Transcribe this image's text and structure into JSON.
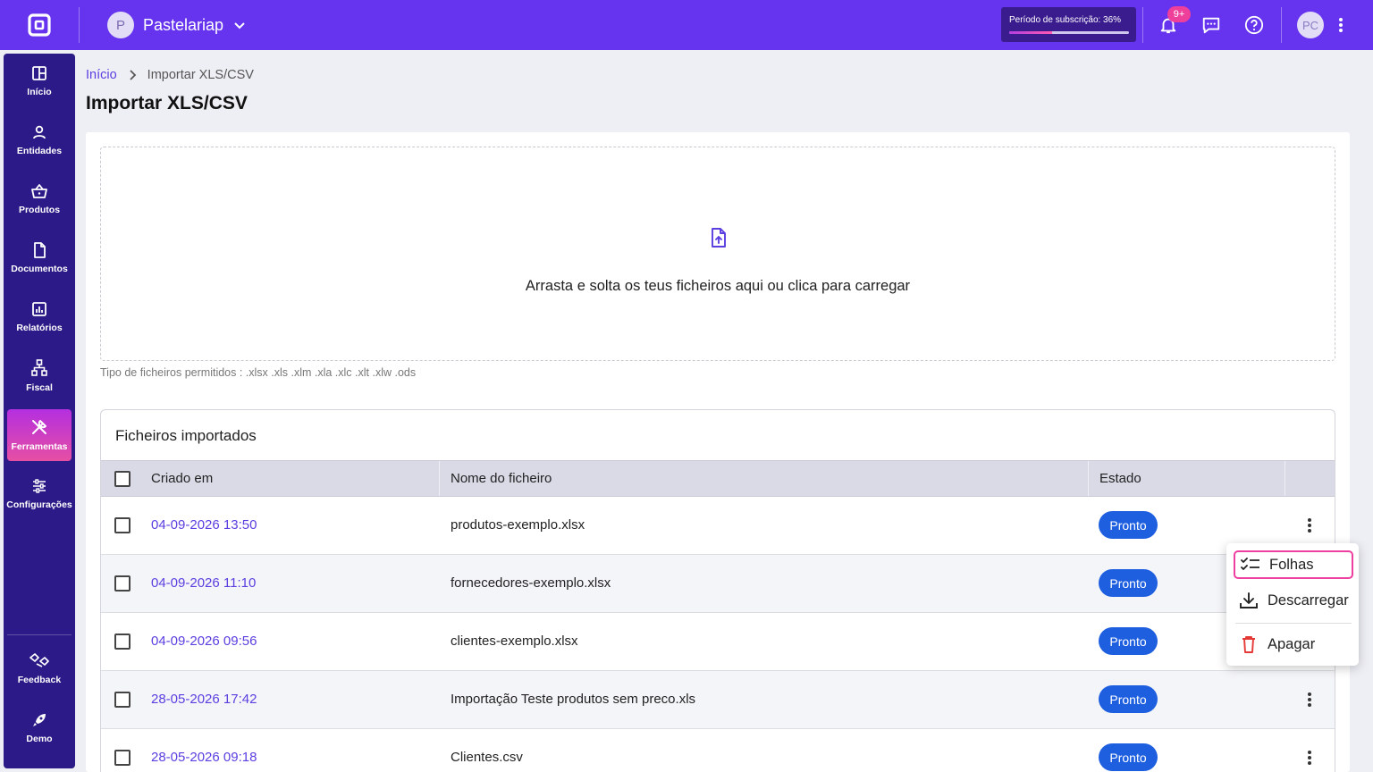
{
  "topbar": {
    "company_initial": "P",
    "company_name": "Pastelariap",
    "subscription_label": "Período de subscrição: 36%",
    "subscription_progress": 0.36,
    "notifications_badge": "9+",
    "user_initials": "PC"
  },
  "sidebar": {
    "items": [
      {
        "label": "Início",
        "icon": "grid-icon"
      },
      {
        "label": "Entidades",
        "icon": "user-icon"
      },
      {
        "label": "Produtos",
        "icon": "basket-icon"
      },
      {
        "label": "Documentos",
        "icon": "document-icon"
      },
      {
        "label": "Relatórios",
        "icon": "chart-icon"
      },
      {
        "label": "Fiscal",
        "icon": "network-icon"
      },
      {
        "label": "Ferramentas",
        "icon": "tools-icon"
      },
      {
        "label": "Configurações",
        "icon": "sliders-icon"
      }
    ],
    "bottom": [
      {
        "label": "Feedback",
        "icon": "feedback-icon"
      },
      {
        "label": "Demo",
        "icon": "rocket-icon"
      }
    ],
    "active": "Ferramentas"
  },
  "breadcrumb": {
    "home": "Início",
    "current": "Importar XLS/CSV"
  },
  "page_title": "Importar XLS/CSV",
  "upload": {
    "text": "Arrasta e solta os teus ficheiros aqui ou clica para carregar",
    "allowed": "Tipo de ficheiros permitidos : .xlsx .xls .xlm .xla .xlc .xlt .xlw .ods"
  },
  "table": {
    "title": "Ficheiros importados",
    "headers": {
      "created": "Criado em",
      "filename": "Nome do ficheiro",
      "status": "Estado"
    },
    "rows": [
      {
        "created": "04-09-2026 13:50",
        "filename": "produtos-exemplo.xlsx",
        "status": "Pronto"
      },
      {
        "created": "04-09-2026 11:10",
        "filename": "fornecedores-exemplo.xlsx",
        "status": "Pronto"
      },
      {
        "created": "04-09-2026 09:56",
        "filename": "clientes-exemplo.xlsx",
        "status": "Pronto"
      },
      {
        "created": "28-05-2026 17:42",
        "filename": "Importação Teste produtos sem preco.xls",
        "status": "Pronto"
      },
      {
        "created": "28-05-2026 09:18",
        "filename": "Clientes.csv",
        "status": "Pronto"
      }
    ]
  },
  "context_menu": {
    "items": [
      {
        "label": "Folhas",
        "icon": "checklist-icon"
      },
      {
        "label": "Descarregar",
        "icon": "download-icon"
      },
      {
        "label": "Apagar",
        "icon": "trash-icon"
      }
    ]
  },
  "colors": {
    "primary": "#6633ee",
    "sidebar": "#2b1a87",
    "status_pill": "#1e5fe0",
    "accent_pink": "#ee3fa0",
    "danger": "#e53935"
  }
}
